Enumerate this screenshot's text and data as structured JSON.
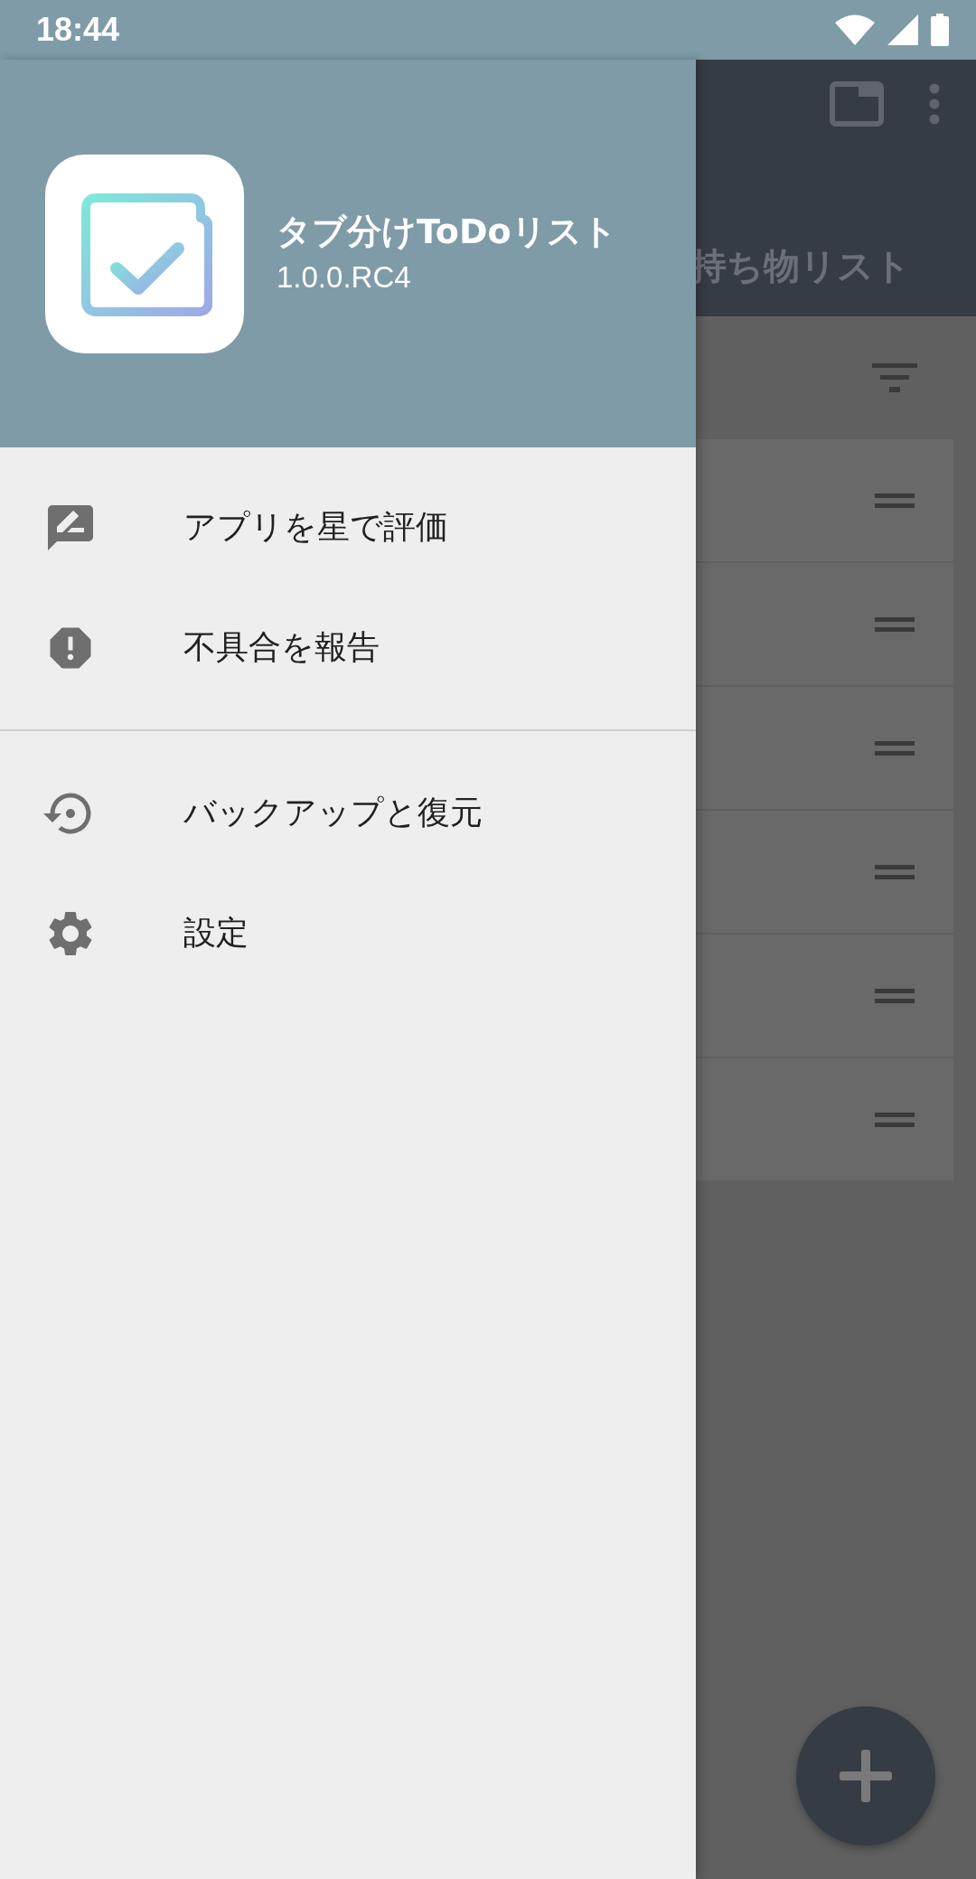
{
  "status_bar": {
    "time": "18:44"
  },
  "drawer": {
    "app_name": "タブ分けToDoリスト",
    "version": "1.0.0.RC4",
    "sections": [
      {
        "items": [
          {
            "label": "アプリを星で評価"
          },
          {
            "label": "不具合を報告"
          }
        ]
      },
      {
        "items": [
          {
            "label": "バックアップと復元"
          },
          {
            "label": "設定"
          }
        ]
      }
    ]
  },
  "background": {
    "tab": "持ち物リスト",
    "cards": [
      {
        "kind": "card"
      },
      {
        "kind": "card"
      },
      {
        "kind": "card"
      },
      {
        "kind": "card"
      },
      {
        "kind": "card"
      },
      {
        "kind": "card"
      }
    ]
  }
}
